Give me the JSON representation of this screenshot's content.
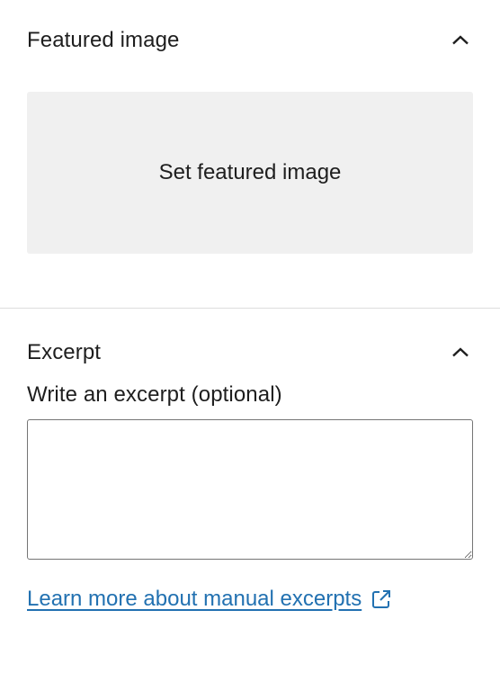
{
  "featured_image_panel": {
    "title": "Featured image",
    "toggle_icon": "chevron-up-icon",
    "set_button_label": "Set featured image"
  },
  "excerpt_panel": {
    "title": "Excerpt",
    "toggle_icon": "chevron-up-icon",
    "field_label": "Write an excerpt (optional)",
    "field_value": "",
    "learn_more_link": "Learn more about manual excerpts",
    "link_icon": "external-link-icon"
  },
  "colors": {
    "text": "#1e1e1e",
    "button_background": "#f0f0f0",
    "divider": "#dddddd",
    "link": "#2271b1",
    "input_border": "#757575"
  }
}
